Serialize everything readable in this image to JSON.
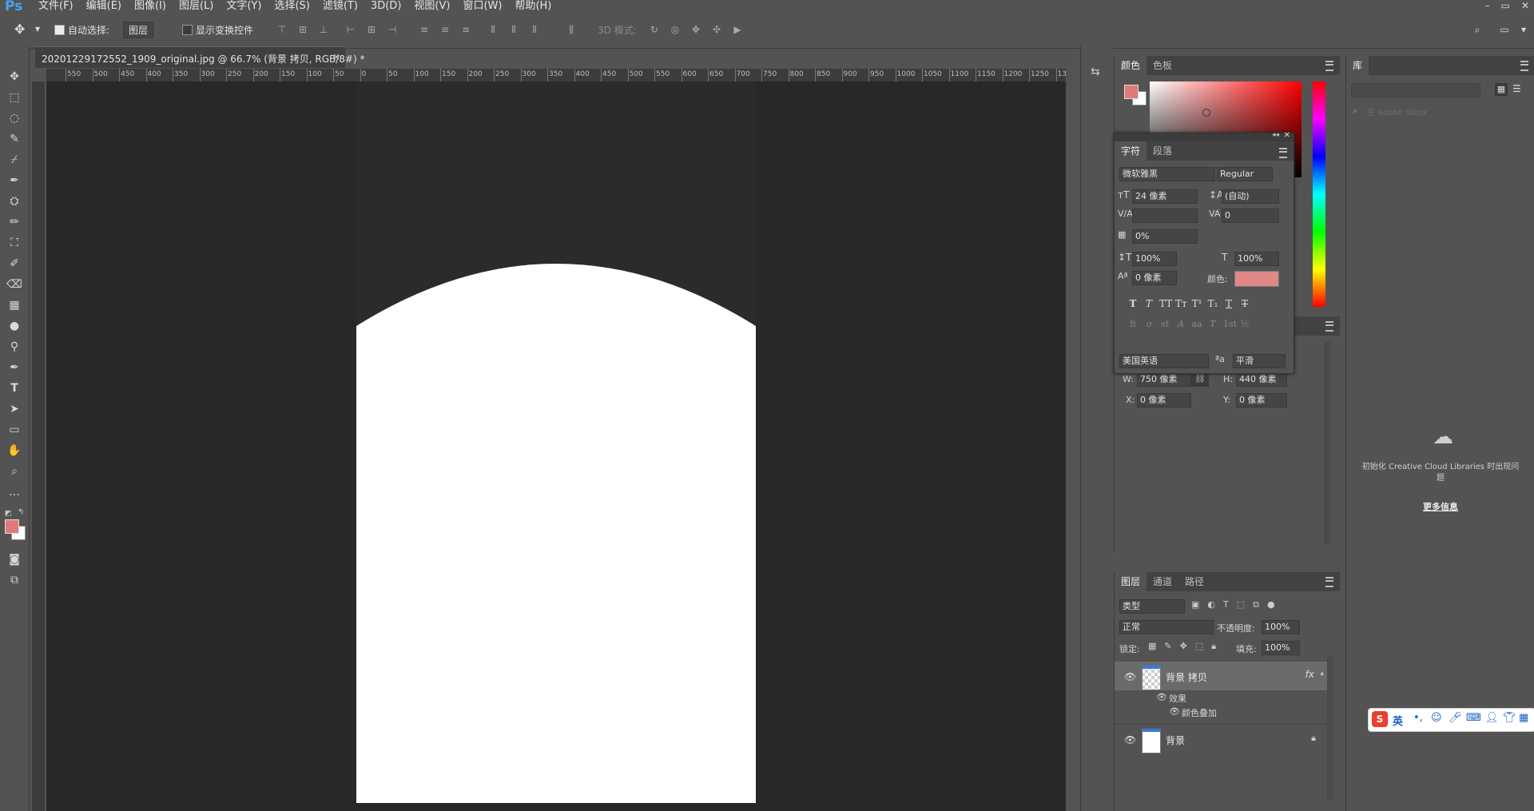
{
  "app": {
    "logo": "Ps"
  },
  "menu": [
    "文件(F)",
    "编辑(E)",
    "图像(I)",
    "图层(L)",
    "文字(Y)",
    "选择(S)",
    "滤镜(T)",
    "3D(D)",
    "视图(V)",
    "窗口(W)",
    "帮助(H)"
  ],
  "window_controls": [
    "–",
    "▭",
    "✕"
  ],
  "options": {
    "auto_select_label": "自动选择:",
    "auto_select_value": "图层",
    "show_transform_label": "显示变换控件",
    "mode3d_label": "3D 模式:"
  },
  "document": {
    "tab_title": "20201229172552_1909_original.jpg @ 66.7% (背景 拷贝, RGB/8#) *",
    "close": "×"
  },
  "ruler": {
    "h_ticks": [
      "550",
      "500",
      "450",
      "400",
      "350",
      "300",
      "250",
      "200",
      "150",
      "100",
      "50",
      "0",
      "50",
      "100",
      "150",
      "200",
      "250",
      "300",
      "350",
      "400",
      "450",
      "500",
      "550",
      "600",
      "650",
      "700",
      "750",
      "800",
      "850",
      "900",
      "950",
      "1000",
      "1050",
      "1100",
      "1150",
      "1200",
      "1250",
      "1300"
    ]
  },
  "color_panel": {
    "tabs": [
      "颜色",
      "色板"
    ],
    "fg_color": "#e07a7a",
    "bg_color": "#ffffff"
  },
  "character_panel": {
    "tabs": [
      "字符",
      "段落"
    ],
    "font_family": "微软雅黑",
    "font_style": "Regular",
    "size": "24 像素",
    "leading": "(自动)",
    "kerning": "",
    "tracking": "0",
    "tsume": "0%",
    "vscale": "100%",
    "hscale": "100%",
    "baseline": "0 像素",
    "color_label": "颜色:",
    "color": "#e08888",
    "style_buttons": [
      "T",
      "T",
      "TT",
      "Tт",
      "T¹",
      "T₁",
      "T",
      "T"
    ],
    "opentype_buttons": [
      "fi",
      "ơ",
      "st",
      "A",
      "aa",
      "T",
      "1st",
      "½"
    ],
    "language": "美国英语",
    "aa_label": "ªa",
    "antialias": "平滑"
  },
  "properties": {
    "w_label": "W:",
    "w": "750 像素",
    "h_label": "H:",
    "h": "440 像素",
    "x_label": "X:",
    "x": "0 像素",
    "y_label": "Y:",
    "y": "0 像素"
  },
  "layers_panel": {
    "tabs": [
      "图层",
      "通道",
      "路径"
    ],
    "filter": "类型",
    "blend_mode": "正常",
    "opacity_label": "不透明度:",
    "opacity": "100%",
    "lock_label": "锁定:",
    "fill_label": "填充:",
    "fill": "100%",
    "layers": [
      {
        "name": "背景 拷贝",
        "fx": "fx",
        "effects_label": "效果",
        "effect": "颜色叠加"
      },
      {
        "name": "背景"
      }
    ]
  },
  "library": {
    "tab": "库",
    "search_placeholder": "在 Adobe Stock",
    "message": "初始化 Creative Cloud Libraries 时出现问题",
    "more_info": "更多信息"
  },
  "ime": {
    "lang": "英"
  }
}
